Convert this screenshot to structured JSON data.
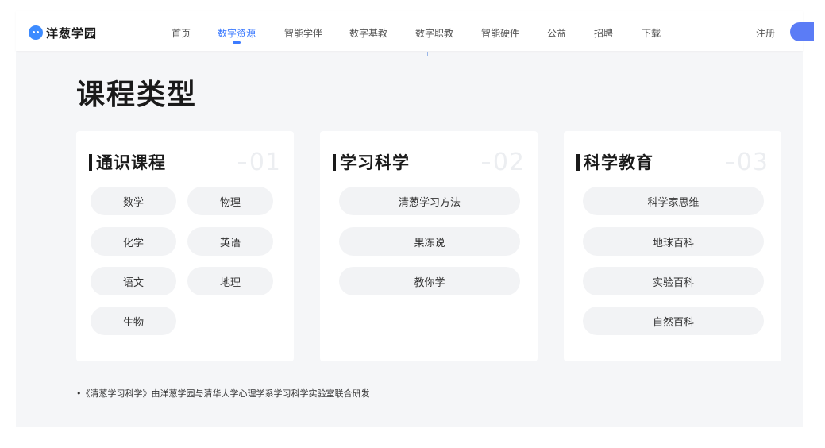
{
  "nav": {
    "logo_text": "洋葱学园",
    "items": [
      "首页",
      "数字资源",
      "智能学伴",
      "数字基教",
      "数字职教",
      "智能硬件",
      "公益",
      "招聘",
      "下载"
    ],
    "active_index": 1,
    "register": "注册"
  },
  "page_title": "课程类型",
  "cards": [
    {
      "title": "通识课程",
      "number": "01",
      "items": [
        "数学",
        "物理",
        "化学",
        "英语",
        "语文",
        "地理",
        "生物"
      ]
    },
    {
      "title": "学习科学",
      "number": "02",
      "items": [
        "清葱学习方法",
        "果冻说",
        "教你学"
      ]
    },
    {
      "title": "科学教育",
      "number": "03",
      "items": [
        "科学家思维",
        "地球百科",
        "实验百科",
        "自然百科"
      ]
    }
  ],
  "footnote": "•《清葱学习科学》由洋葱学园与清华大学心理学系学习科学实验室联合研发",
  "colors": {
    "accent": "#3d7bff",
    "page_bg": "#f5f6f8",
    "card_bg": "#ffffff",
    "pill_bg": "#f2f3f5"
  }
}
